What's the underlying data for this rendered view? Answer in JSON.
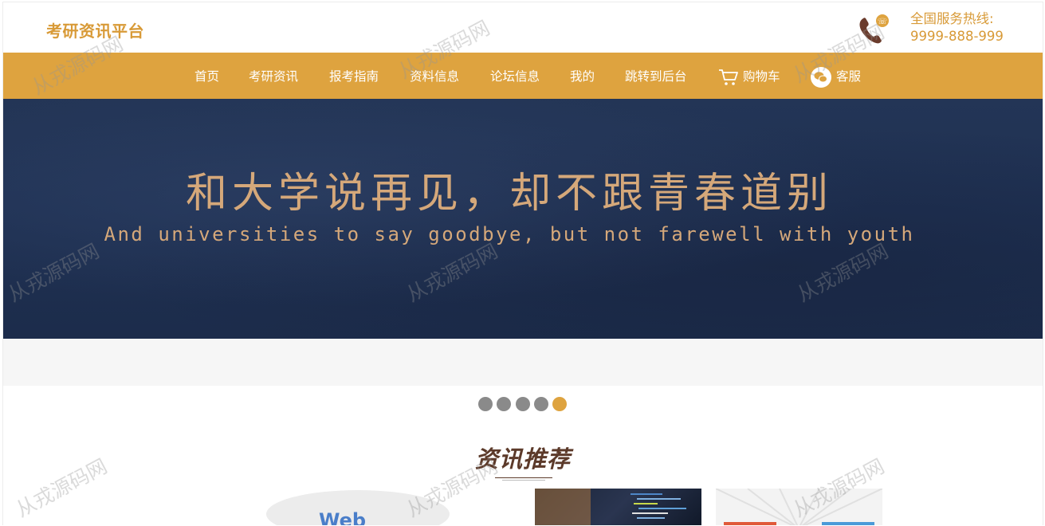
{
  "header": {
    "brand": "考研资讯平台",
    "hotline_label": "全国服务热线:",
    "hotline_number": "9999-888-999"
  },
  "nav": {
    "items": [
      {
        "label": "首页"
      },
      {
        "label": "考研资讯"
      },
      {
        "label": "报考指南"
      },
      {
        "label": "资料信息"
      },
      {
        "label": "论坛信息"
      },
      {
        "label": "我的"
      },
      {
        "label": "跳转到后台"
      },
      {
        "label": "购物车",
        "icon": "cart-icon"
      },
      {
        "label": "客服",
        "icon": "wechat-icon"
      }
    ]
  },
  "banner": {
    "title": "和大学说再见，却不跟青春道别",
    "subtitle": "And universities to say goodbye, but not farewell with youth",
    "slide_count": 5,
    "active_slide": 5
  },
  "section": {
    "title": "资讯推荐"
  },
  "cards": {
    "card1_text": "Web"
  },
  "watermark": "从戎源码网",
  "colors": {
    "accent": "#dea33f",
    "brand_text": "#d89a37",
    "banner_bg": "#1f3153",
    "banner_text": "#d5a87a",
    "heading": "#5c3a2a",
    "dot_inactive": "#8a8a8a"
  }
}
